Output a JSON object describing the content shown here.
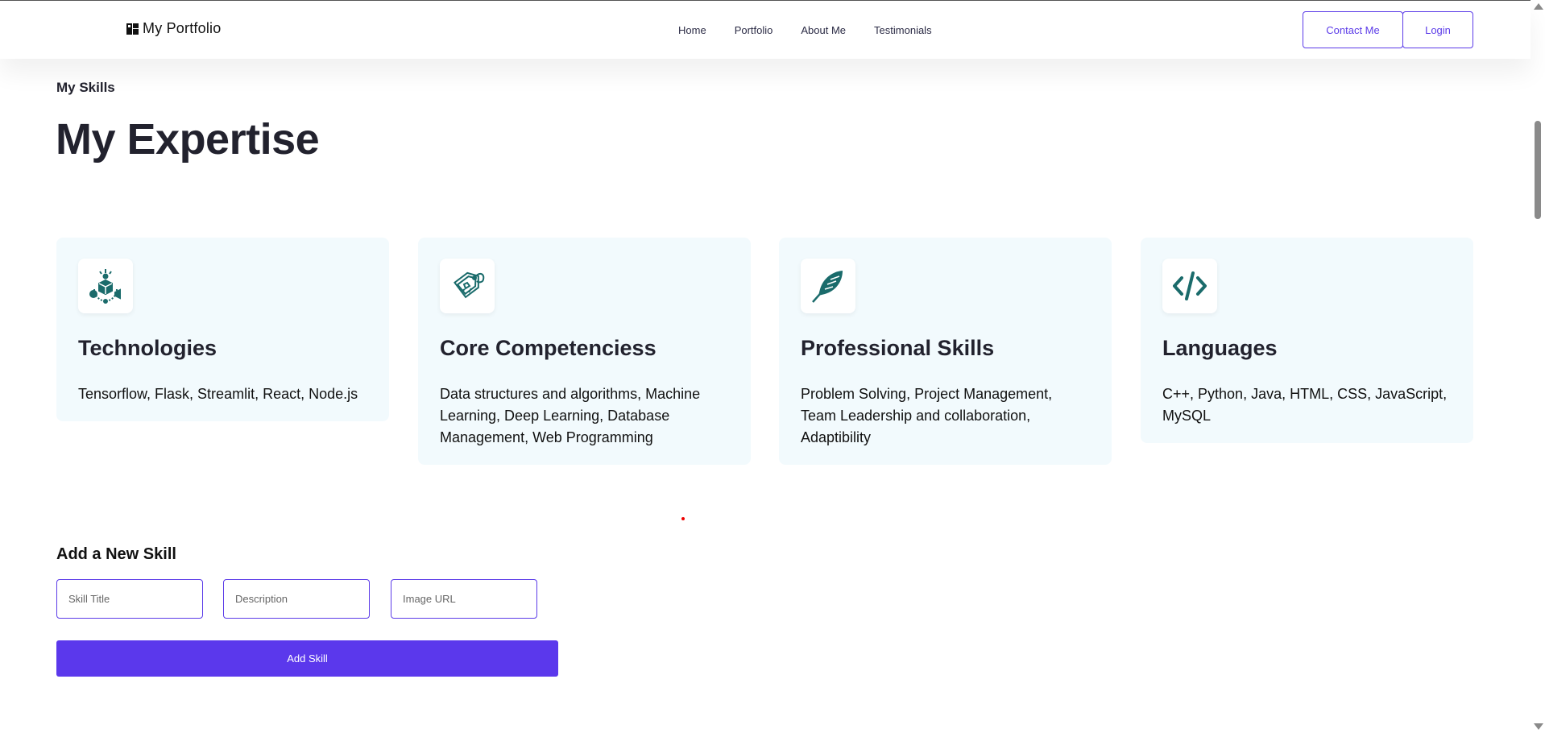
{
  "nav": {
    "brand": "My Portfolio",
    "links": [
      "Home",
      "Portfolio",
      "About Me",
      "Testimonials"
    ],
    "contact_label": "Contact Me",
    "login_label": "Login"
  },
  "skills_section": {
    "label": "My Skills",
    "title": "My Expertise",
    "cards": [
      {
        "icon": "technology-network-icon",
        "title": "Technologies",
        "description": "Tensorflow, Flask, Streamlit, React, Node.js"
      },
      {
        "icon": "tag-badge-icon",
        "title": "Core Competenciess",
        "description": "Data structures and algorithms, Machine Learning, Deep Learning, Database Management, Web Programming"
      },
      {
        "icon": "feather-quill-icon",
        "title": "Professional Skills",
        "description": "Problem Solving, Project Management, Team Leadership and collaboration, Adaptibility"
      },
      {
        "icon": "code-brackets-icon",
        "title": "Languages",
        "description": "C++, Python, Java, HTML, CSS, JavaScript, MySQL"
      }
    ]
  },
  "add_skill_form": {
    "title": "Add a New Skill",
    "title_placeholder": "Skill Title",
    "description_placeholder": "Description",
    "image_placeholder": "Image URL",
    "submit_label": "Add Skill"
  },
  "colors": {
    "accent": "#5b38ec",
    "icon_teal": "#1a6b6b",
    "card_bg": "#f2fafd",
    "heading": "#22222e"
  }
}
